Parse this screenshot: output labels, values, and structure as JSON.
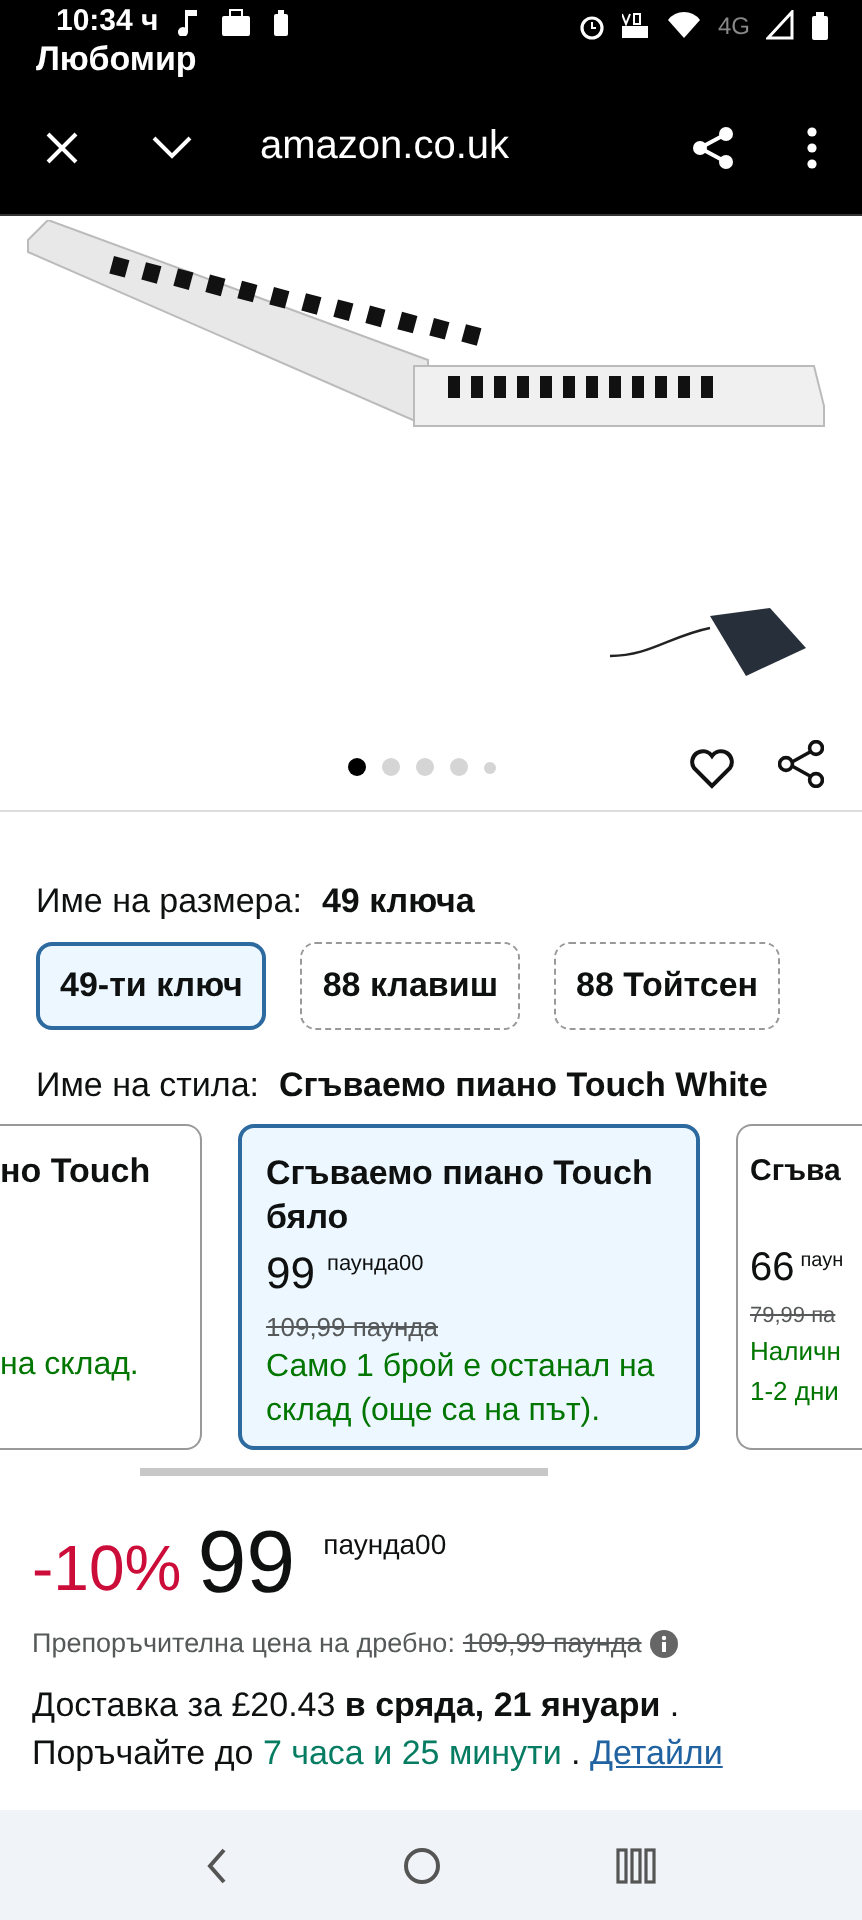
{
  "status_bar": {
    "time": "10:34 ч",
    "overlay_name": "Любомир",
    "network": "4G"
  },
  "browser_bar": {
    "url": "amazon.co.uk"
  },
  "gallery": {
    "dots": [
      {
        "selected": true
      },
      {
        "selected": false
      },
      {
        "selected": false
      },
      {
        "selected": false
      },
      {
        "selected": false
      }
    ]
  },
  "size": {
    "label": "Име на размера:",
    "value": "49 ключа",
    "options": [
      {
        "label": "49-ти ключ",
        "selected": true
      },
      {
        "label": "88 клавиш",
        "selected": false
      },
      {
        "label": "88 Тойтсен",
        "selected": false
      }
    ]
  },
  "style": {
    "label": "Име на стила:",
    "value": "Сгъваемо пиано Touch White"
  },
  "style_cards": [
    {
      "kind": "cut_left",
      "title": "но Touch",
      "stock": "на склад.",
      "selected": false
    },
    {
      "kind": "full",
      "title": "Сгъваемо пиано Touch бяло",
      "price": "99",
      "price_suffix": "паунда00",
      "was_price": "109,99 паунда",
      "stock": "Само 1 брой е останал на склад (още са на път).",
      "selected": true
    },
    {
      "kind": "cut_right",
      "title": "Сгъва",
      "price": "66",
      "price_suffix": "паун",
      "was_price": "79,99 па",
      "stock": "Наличн 1-2 дни",
      "selected": false
    }
  ],
  "price": {
    "discount": "-10%",
    "whole": "99",
    "suffix": "паунда00",
    "rrp_label": "Препоръчителна цена на дребно:",
    "rrp_value": "109,99 паунда"
  },
  "delivery": {
    "text": "Доставка за £20.43 **в сряда, 21 януари** .",
    "order_prefix": "Поръчайте до",
    "countdown": "7 часа и 25 минути",
    "order_suffix": ".",
    "link": "Детайли"
  }
}
